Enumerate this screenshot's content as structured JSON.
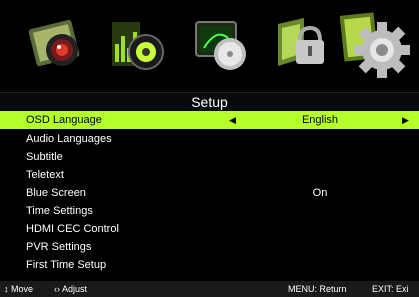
{
  "icons": [
    {
      "name": "picture-icon"
    },
    {
      "name": "sound-icon"
    },
    {
      "name": "channel-icon"
    },
    {
      "name": "lock-icon"
    },
    {
      "name": "setup-icon",
      "selected": true
    }
  ],
  "header": {
    "title": "Setup"
  },
  "menu": {
    "items": [
      {
        "label": "OSD Language",
        "value": "English",
        "selected": true
      },
      {
        "label": "Audio Languages",
        "value": ""
      },
      {
        "label": "Subtitle",
        "value": ""
      },
      {
        "label": "Teletext",
        "value": ""
      },
      {
        "label": "Blue Screen",
        "value": "On"
      },
      {
        "label": "Time Settings",
        "value": ""
      },
      {
        "label": "HDMI CEC Control",
        "value": ""
      },
      {
        "label": "PVR Settings",
        "value": ""
      },
      {
        "label": "First Time Setup",
        "value": ""
      }
    ]
  },
  "footer": {
    "move": "↕ Move",
    "adjust": "‹› Adjust",
    "menu_return": "MENU: Return",
    "exit": "EXIT: Exi"
  },
  "colors": {
    "highlight": "#b5ff2a",
    "background": "#000000"
  }
}
